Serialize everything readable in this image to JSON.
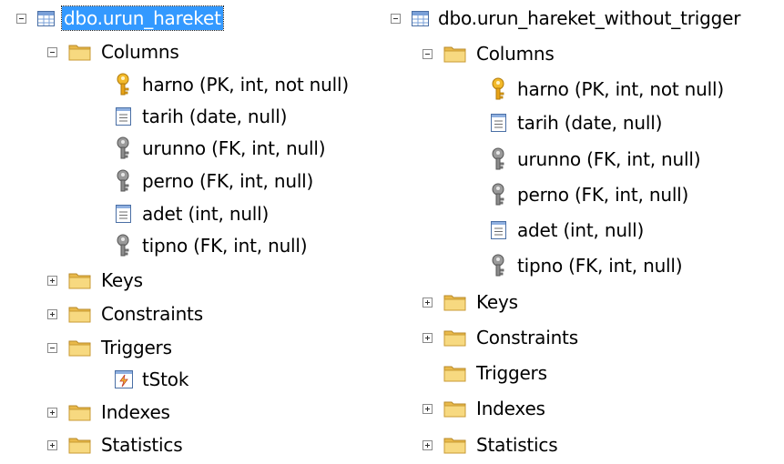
{
  "left": {
    "table_name": "dbo.urun_hareket",
    "columns_label": "Columns",
    "columns": [
      {
        "label": "harno (PK, int, not null)",
        "icon": "primary-key-icon"
      },
      {
        "label": "tarih (date, null)",
        "icon": "column-icon"
      },
      {
        "label": "urunno (FK, int, null)",
        "icon": "foreign-key-icon"
      },
      {
        "label": "perno (FK, int, null)",
        "icon": "foreign-key-icon"
      },
      {
        "label": "adet (int, null)",
        "icon": "column-icon"
      },
      {
        "label": "tipno (FK, int, null)",
        "icon": "foreign-key-icon"
      }
    ],
    "keys_label": "Keys",
    "constraints_label": "Constraints",
    "triggers_label": "Triggers",
    "trigger_items": [
      "tStok"
    ],
    "indexes_label": "Indexes",
    "statistics_label": "Statistics"
  },
  "right": {
    "table_name": "dbo.urun_hareket_without_trigger",
    "columns_label": "Columns",
    "columns": [
      {
        "label": "harno (PK, int, not null)",
        "icon": "primary-key-icon"
      },
      {
        "label": "tarih (date, null)",
        "icon": "column-icon"
      },
      {
        "label": "urunno (FK, int, null)",
        "icon": "foreign-key-icon"
      },
      {
        "label": "perno (FK, int, null)",
        "icon": "foreign-key-icon"
      },
      {
        "label": "adet (int, null)",
        "icon": "column-icon"
      },
      {
        "label": "tipno (FK, int, null)",
        "icon": "foreign-key-icon"
      }
    ],
    "keys_label": "Keys",
    "constraints_label": "Constraints",
    "triggers_label": "Triggers",
    "indexes_label": "Indexes",
    "statistics_label": "Statistics"
  },
  "colors": {
    "selection": "#3399ff",
    "folder": "#f5d36a",
    "primary_key": "#e8a317",
    "foreign_key": "#8c8c8c"
  }
}
